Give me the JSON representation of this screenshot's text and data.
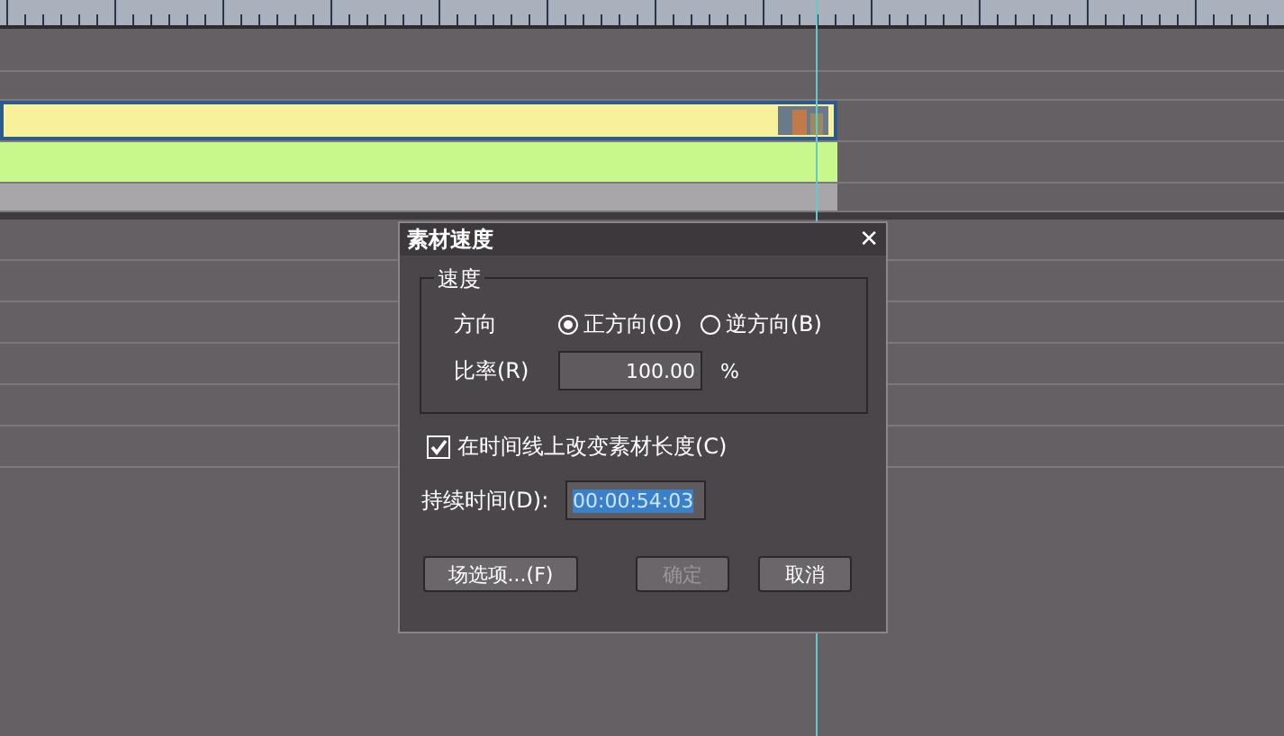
{
  "dialog": {
    "title": "素材速度",
    "close": "✕",
    "speed_group": {
      "legend": "速度",
      "direction_label": "方向",
      "directions": [
        {
          "label": "正方向(O)",
          "selected": true
        },
        {
          "label": "逆方向(B)",
          "selected": false
        }
      ],
      "rate_label": "比率(R)",
      "rate_value": "100.00",
      "rate_unit": "%"
    },
    "change_length": {
      "label": "在时间线上改变素材长度(C)",
      "checked": true
    },
    "duration_label": "持续时间(D):",
    "duration_value": "00:00:54:03",
    "buttons": [
      {
        "label": "场选项...(F)",
        "disabled": false
      },
      {
        "label": "确定",
        "disabled": true
      },
      {
        "label": "取消",
        "disabled": false
      }
    ]
  }
}
